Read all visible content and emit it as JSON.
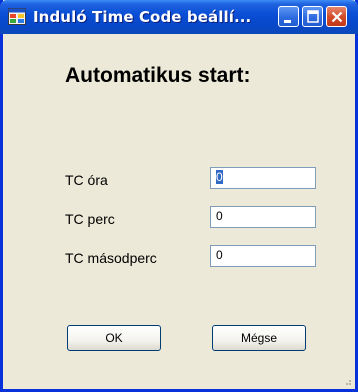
{
  "window": {
    "title": "Induló Time Code beállí...",
    "icon": "window-app-icon"
  },
  "title_buttons": {
    "minimize": "minimize-icon",
    "maximize": "maximize-icon",
    "close": "close-icon"
  },
  "heading": "Automatikus start:",
  "fields": [
    {
      "label": "TC óra",
      "value": "0"
    },
    {
      "label": "TC perc",
      "value": "0"
    },
    {
      "label": "TC másodperc",
      "value": "0"
    }
  ],
  "buttons": {
    "ok": "OK",
    "cancel": "Mégse"
  },
  "colors": {
    "titlebar": "#0a4fd6",
    "window_bg": "#ece9d8",
    "close_button": "#d14a26",
    "selection": "#316ac5"
  }
}
